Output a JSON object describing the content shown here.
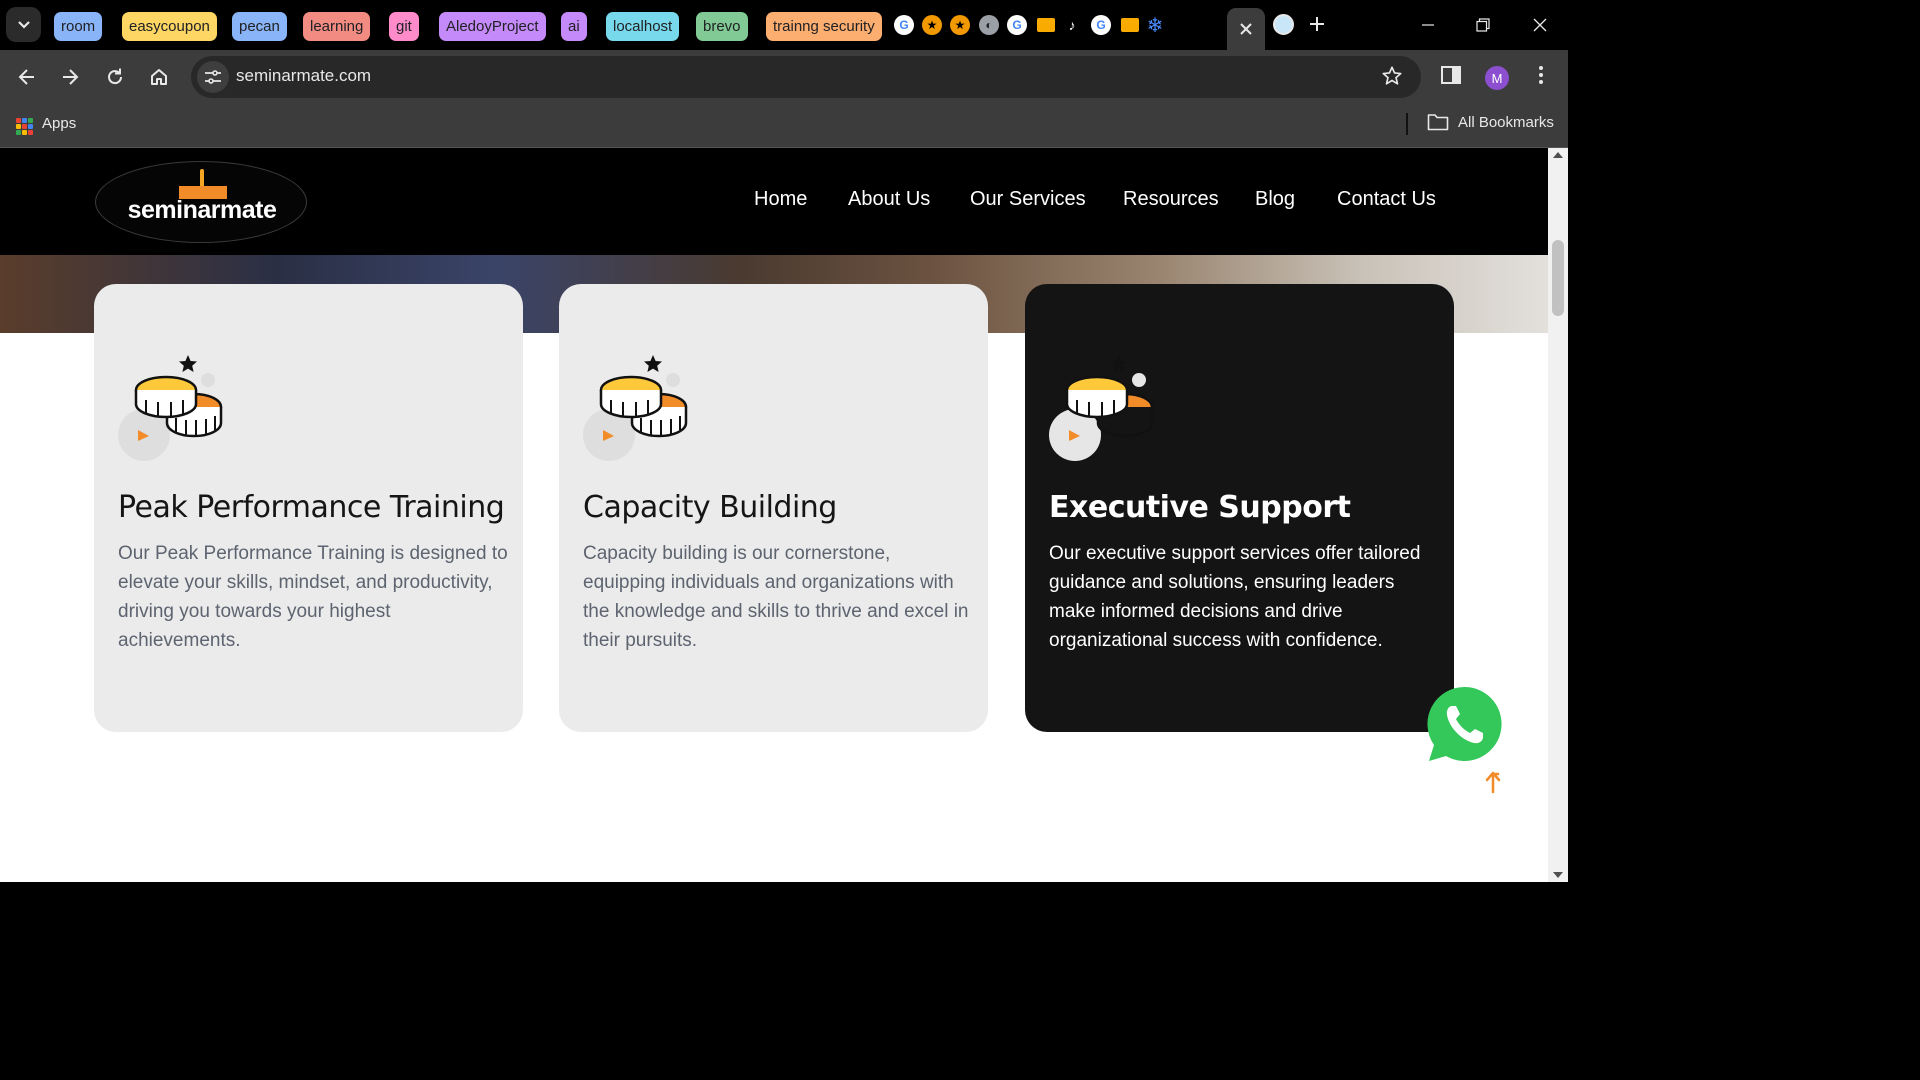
{
  "browser": {
    "tab_groups": [
      {
        "label": "room",
        "color": "#8ab4f8"
      },
      {
        "label": "easycoupon",
        "color": "#fdd663"
      },
      {
        "label": "pecan",
        "color": "#8ab4f8"
      },
      {
        "label": "learning",
        "color": "#f28b82"
      },
      {
        "label": "git",
        "color": "#ff8bcb"
      },
      {
        "label": "AledoyProject",
        "color": "#c58af9"
      },
      {
        "label": "ai",
        "color": "#c58af9"
      },
      {
        "label": "localhost",
        "color": "#78d9ec"
      },
      {
        "label": "brevo",
        "color": "#81c995"
      },
      {
        "label": "trainng security",
        "color": "#fcad70"
      }
    ],
    "pinned_favicons": [
      "google-icon",
      "star-icon",
      "star-icon",
      "globe-icon",
      "google-icon",
      "news-icon",
      "tiktok-icon",
      "google-icon",
      "news-icon",
      "snowflake-icon",
      "microsoft-icon",
      "microsoft-icon"
    ],
    "url": "seminarmate.com",
    "profile_initial": "M",
    "bookmarks": {
      "apps_label": "Apps",
      "all_bookmarks_label": "All Bookmarks"
    }
  },
  "site": {
    "logo_text": "seminarmate",
    "accent_color": "#f28c28",
    "nav": [
      {
        "label": "Home"
      },
      {
        "label": "About Us"
      },
      {
        "label": "Our Services"
      },
      {
        "label": "Resources"
      },
      {
        "label": "Blog"
      },
      {
        "label": "Contact Us"
      }
    ],
    "cards": [
      {
        "title": "Peak Performance Training",
        "text": "Our Peak Performance Training is designed to elevate your skills, mindset, and productivity, driving you towards your highest achievements.",
        "theme": "light",
        "icon": "coins-icon"
      },
      {
        "title": "Capacity Building",
        "text": "Capacity building is our cornerstone, equipping individuals and organizations with the knowledge and skills to thrive and excel in their pursuits.",
        "theme": "light",
        "icon": "coins-icon"
      },
      {
        "title": "Executive Support",
        "text": "Our executive support services offer tailored guidance and solutions, ensuring leaders make informed decisions and drive organizational success with confidence.",
        "theme": "dark",
        "icon": "coins-icon"
      }
    ]
  }
}
